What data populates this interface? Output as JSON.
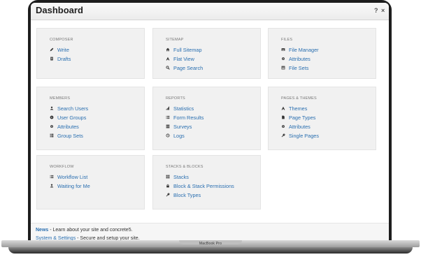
{
  "window": {
    "title": "Dashboard",
    "help_label": "?",
    "close_label": "×"
  },
  "device": {
    "model_label": "MacBook Pro"
  },
  "panels": [
    {
      "title": "Composer",
      "items": [
        {
          "label": "Write",
          "icon": "pencil-icon"
        },
        {
          "label": "Drafts",
          "icon": "document-icon"
        }
      ]
    },
    {
      "title": "Sitemap",
      "items": [
        {
          "label": "Full Sitemap",
          "icon": "home-icon"
        },
        {
          "label": "Flat View",
          "icon": "font-icon"
        },
        {
          "label": "Page Search",
          "icon": "search-icon"
        }
      ]
    },
    {
      "title": "Files",
      "items": [
        {
          "label": "File Manager",
          "icon": "picture-icon"
        },
        {
          "label": "Attributes",
          "icon": "cog-icon"
        },
        {
          "label": "File Sets",
          "icon": "list-alt-icon"
        }
      ]
    },
    {
      "title": "Members",
      "items": [
        {
          "label": "Search Users",
          "icon": "user-icon"
        },
        {
          "label": "User Groups",
          "icon": "globe-icon"
        },
        {
          "label": "Attributes",
          "icon": "cog-icon"
        },
        {
          "label": "Group Sets",
          "icon": "th-list-icon"
        }
      ]
    },
    {
      "title": "Reports",
      "items": [
        {
          "label": "Statistics",
          "icon": "signal-icon"
        },
        {
          "label": "Form Results",
          "icon": "list-icon"
        },
        {
          "label": "Surveys",
          "icon": "tasks-icon"
        },
        {
          "label": "Logs",
          "icon": "clock-icon"
        }
      ]
    },
    {
      "title": "Pages & Themes",
      "items": [
        {
          "label": "Themes",
          "icon": "font-icon"
        },
        {
          "label": "Page Types",
          "icon": "file-icon"
        },
        {
          "label": "Attributes",
          "icon": "cog-icon"
        },
        {
          "label": "Single Pages",
          "icon": "wrench-icon"
        }
      ]
    },
    {
      "title": "Workflow",
      "items": [
        {
          "label": "Workflow List",
          "icon": "list-icon"
        },
        {
          "label": "Waiting for Me",
          "icon": "user-icon"
        }
      ]
    },
    {
      "title": "Stacks & Blocks",
      "items": [
        {
          "label": "Stacks",
          "icon": "th-icon"
        },
        {
          "label": "Block & Stack Permissions",
          "icon": "lock-icon"
        },
        {
          "label": "Block Types",
          "icon": "wrench-icon"
        }
      ]
    }
  ],
  "footer": {
    "news_link": "News",
    "news_text": " - Learn about your site and concrete5.",
    "system_link": "System & Settings",
    "system_text": " - Secure and setup your site."
  },
  "colors": {
    "link": "#2a6fb0",
    "panel_bg": "#f1f1f1",
    "heading": "#777777"
  }
}
